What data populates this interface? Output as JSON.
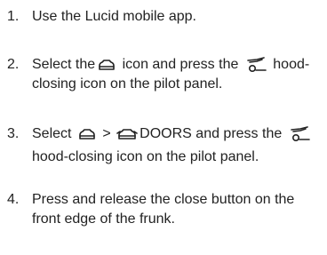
{
  "steps": [
    {
      "number": "1.",
      "text": "Use the Lucid mobile app."
    },
    {
      "number": "2.",
      "part1": "Select the",
      "icon1": "car-outline-icon",
      "part2": "icon and press the",
      "icon2": "hood-closing-icon",
      "part3": "hood-closing icon on the pilot panel."
    },
    {
      "number": "3.",
      "part1": "Select",
      "icon1": "car-outline-icon",
      "part2": ">",
      "icon2": "car-doors-icon",
      "part3": "DOORS and press the",
      "icon3": "hood-closing-icon",
      "part4": "hood-closing icon on the pilot panel."
    },
    {
      "number": "4.",
      "text": "Press and release the close button on the front edge of the frunk."
    }
  ]
}
